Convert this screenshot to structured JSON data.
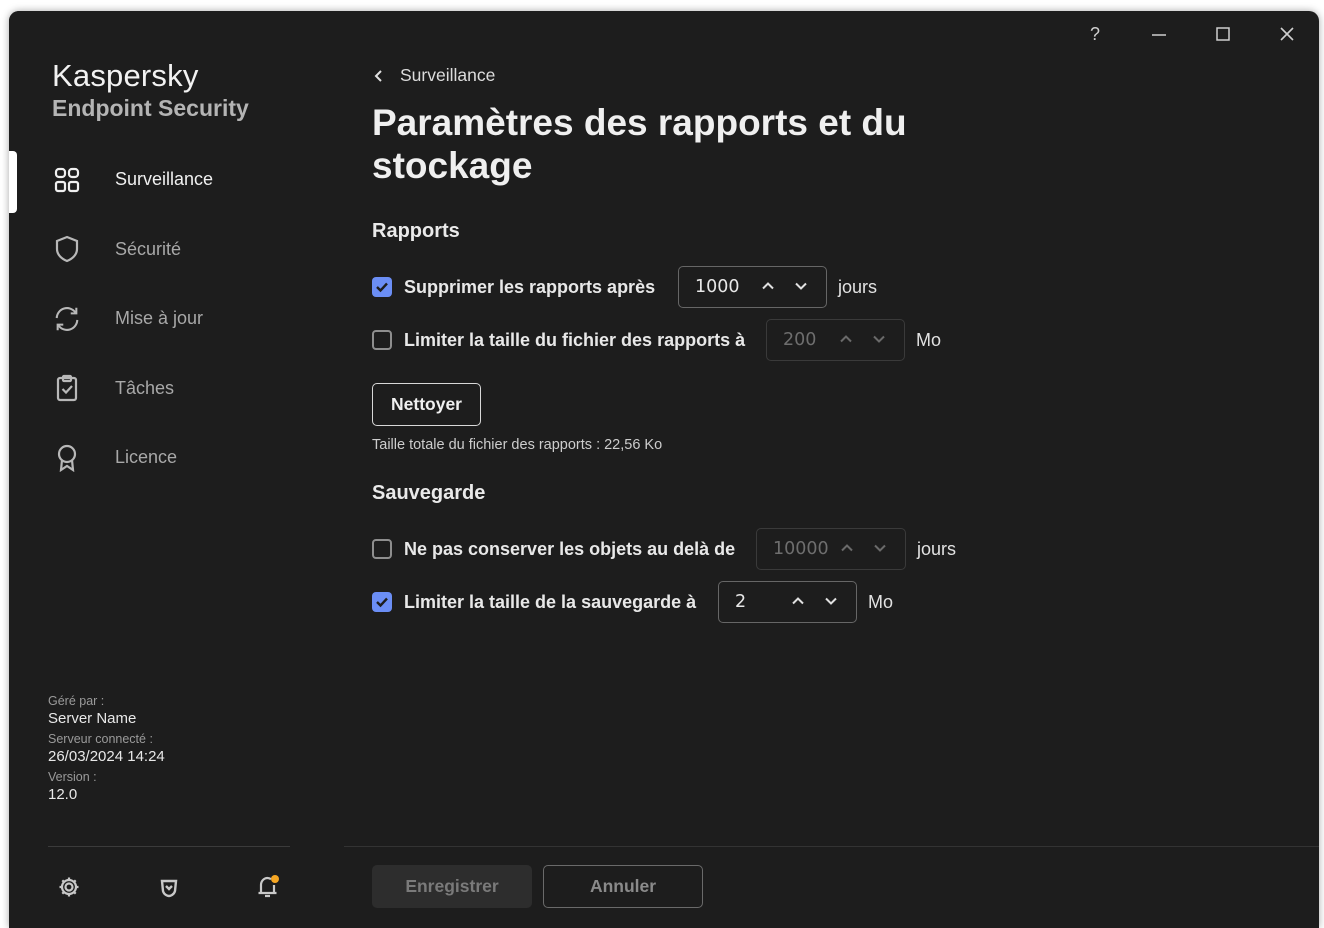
{
  "app": {
    "name": "Kaspersky",
    "product": "Endpoint Security"
  },
  "window_controls": {
    "help": "?"
  },
  "sidebar": {
    "items": [
      {
        "label": "Surveillance",
        "icon": "dashboard-icon",
        "active": true
      },
      {
        "label": "Sécurité",
        "icon": "shield-icon",
        "active": false
      },
      {
        "label": "Mise à jour",
        "icon": "refresh-icon",
        "active": false
      },
      {
        "label": "Tâches",
        "icon": "clipboard-check-icon",
        "active": false
      },
      {
        "label": "Licence",
        "icon": "license-award-icon",
        "active": false
      }
    ],
    "meta": {
      "managed_by_label": "Géré par :",
      "managed_by_value": "Server Name",
      "server_connected_label": "Serveur connecté :",
      "server_connected_value": "26/03/2024 14:24",
      "version_label": "Version :",
      "version_value": "12.0"
    },
    "tools": [
      "settings-icon",
      "support-icon",
      "notifications-icon"
    ]
  },
  "main": {
    "back_label": "Surveillance",
    "title": "Paramètres des rapports et du stockage",
    "reports": {
      "heading": "Rapports",
      "delete_after": {
        "label": "Supprimer les rapports après",
        "checked": true,
        "value": "1000",
        "unit": "jours"
      },
      "limit_size": {
        "label": "Limiter la taille du fichier des rapports à",
        "checked": false,
        "value": "200",
        "unit": "Mo"
      },
      "clean_button": "Nettoyer",
      "total_size": "Taille totale du fichier des rapports : 22,56 Ko"
    },
    "backup": {
      "heading": "Sauvegarde",
      "no_keep": {
        "label": "Ne pas conserver les objets au delà de",
        "checked": false,
        "value": "10000",
        "unit": "jours"
      },
      "limit_backup": {
        "label": "Limiter la taille de la sauvegarde à",
        "checked": true,
        "value": "2",
        "unit": "Mo"
      }
    }
  },
  "footer": {
    "save": "Enregistrer",
    "cancel": "Annuler"
  },
  "colors": {
    "accent": "#6b8ef5",
    "background": "#1d1d1d",
    "notification_dot": "#f5a623"
  }
}
